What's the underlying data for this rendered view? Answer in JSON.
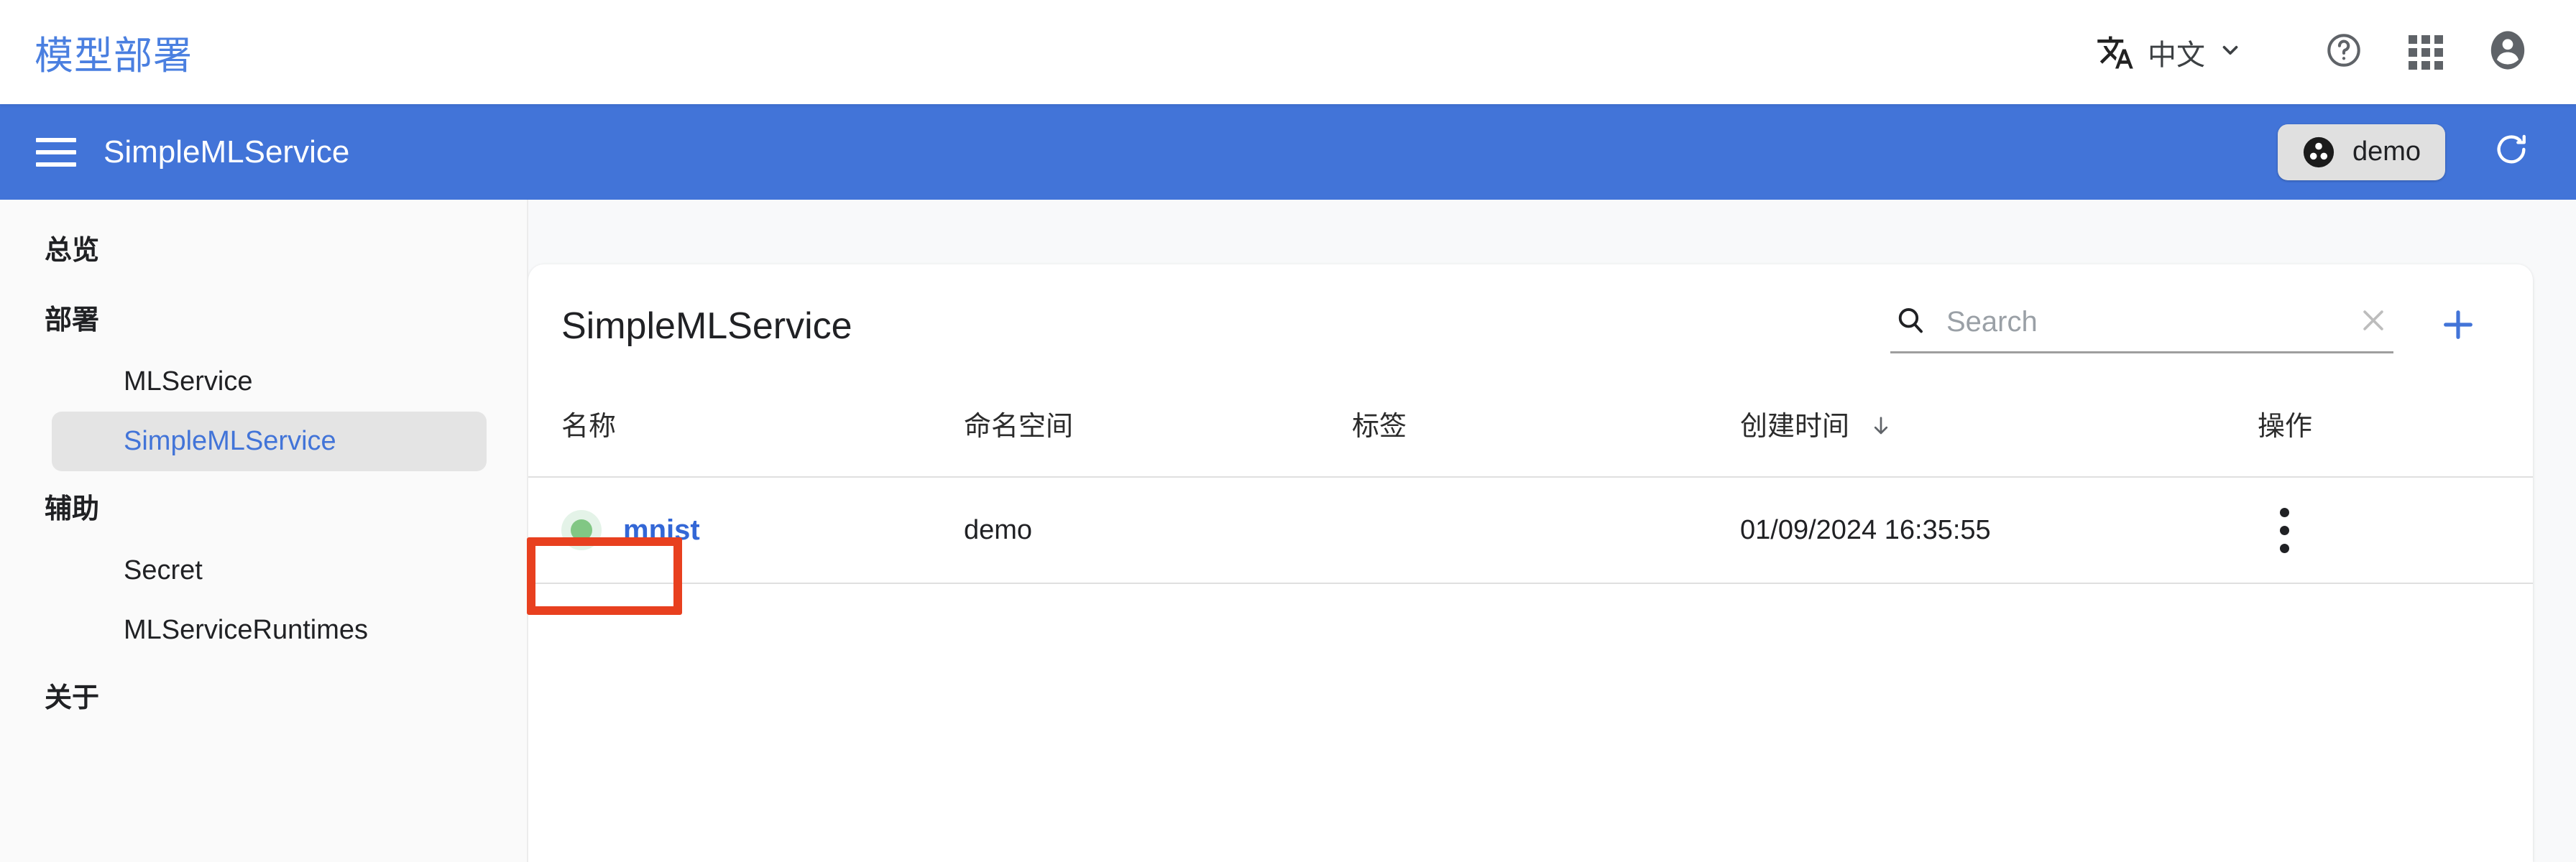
{
  "topbar": {
    "app_title": "模型部署",
    "language": {
      "label": "中文",
      "translate_icon": "translate-icon",
      "chevron_icon": "chevron-down-icon"
    },
    "help_icon": "help-circle-icon",
    "apps_icon": "apps-grid-icon",
    "account_icon": "account-circle-icon"
  },
  "appbar": {
    "menu_icon": "hamburger-menu-icon",
    "service_name": "SimpleMLService",
    "namespace_chip": {
      "label": "demo",
      "icon": "namespace-icon"
    },
    "refresh_icon": "refresh-icon"
  },
  "sidebar": {
    "items": [
      {
        "label": "总览",
        "type": "section",
        "selected": false
      },
      {
        "label": "部署",
        "type": "section",
        "selected": false
      },
      {
        "label": "MLService",
        "type": "item",
        "selected": false
      },
      {
        "label": "SimpleMLService",
        "type": "item",
        "selected": true
      },
      {
        "label": "辅助",
        "type": "section",
        "selected": false
      },
      {
        "label": "Secret",
        "type": "item",
        "selected": false
      },
      {
        "label": "MLServiceRuntimes",
        "type": "item",
        "selected": false
      },
      {
        "label": "关于",
        "type": "section",
        "selected": false
      }
    ]
  },
  "card": {
    "title": "SimpleMLService",
    "search": {
      "value": "",
      "placeholder": "Search",
      "search_icon": "search-icon",
      "clear_icon": "close-icon"
    },
    "add_icon": "plus-icon",
    "table": {
      "columns": [
        {
          "label": "名称",
          "sorted": false
        },
        {
          "label": "命名空间",
          "sorted": false
        },
        {
          "label": "标签",
          "sorted": false
        },
        {
          "label": "创建时间",
          "sorted": true,
          "sort_direction": "desc",
          "sort_icon": "arrow-down-icon"
        },
        {
          "label": "操作",
          "sorted": false
        }
      ],
      "rows": [
        {
          "status": "running",
          "name": "mnist",
          "namespace": "demo",
          "labels": "",
          "created_at": "01/09/2024 16:35:55",
          "actions_icon": "more-vert-icon"
        }
      ]
    }
  },
  "annotation": {
    "highlight_color": "#e8401f",
    "target": "mnist"
  },
  "colors": {
    "brand_blue": "#4274d8",
    "link_blue": "#3367d6",
    "title_blue": "#4a7fe0",
    "status_green": "#81c784",
    "highlight_red": "#e8401f"
  }
}
